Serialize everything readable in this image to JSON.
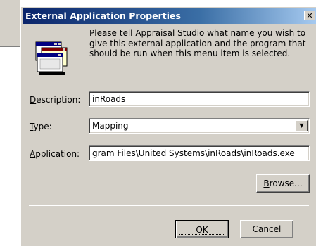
{
  "dialog": {
    "title": "External Application Properties",
    "close_glyph": "✕",
    "icon": "application-windows-icon",
    "prompt": "Please tell Appraisal Studio what name you wish to give this external application and the program that should be run when this menu item is selected."
  },
  "form": {
    "description": {
      "label_key": "D",
      "label_rest": "escription:",
      "value": "inRoads"
    },
    "type": {
      "label_key": "T",
      "label_rest": "ype:",
      "value": "Mapping"
    },
    "application": {
      "label_key": "A",
      "label_rest": "pplication:",
      "value": "gram Files\\United Systems\\inRoads\\inRoads.exe"
    }
  },
  "buttons": {
    "browse_key": "B",
    "browse_rest": "rowse...",
    "ok": "OK",
    "cancel": "Cancel"
  }
}
